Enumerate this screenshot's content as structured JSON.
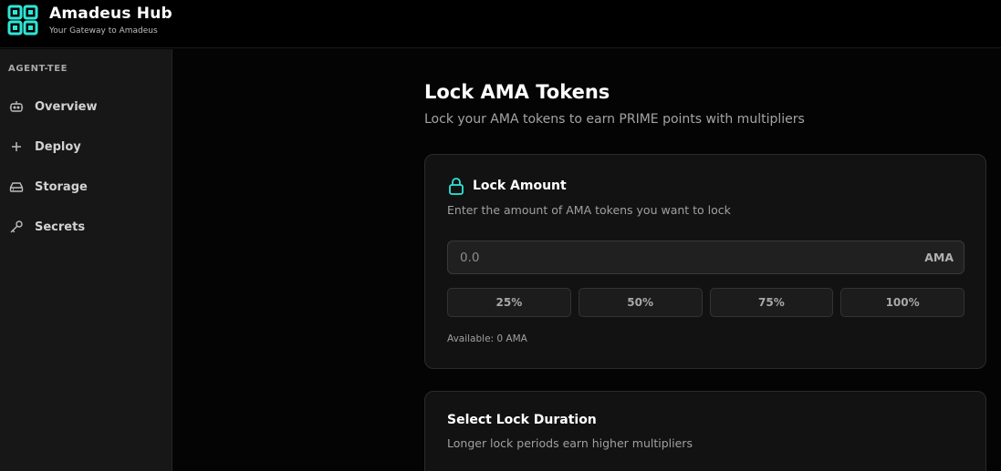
{
  "header": {
    "title": "Amadeus Hub",
    "subtitle": "Your Gateway to Amadeus",
    "logo_icon": "amadeus-logo-icon",
    "accent": "#2ee6d6"
  },
  "sidebar": {
    "heading": "AGENT-TEE",
    "items": [
      {
        "label": "Overview",
        "icon": "robot-icon"
      },
      {
        "label": "Deploy",
        "icon": "plus-icon"
      },
      {
        "label": "Storage",
        "icon": "hard-drive-icon"
      },
      {
        "label": "Secrets",
        "icon": "key-icon"
      }
    ]
  },
  "main": {
    "title": "Lock AMA Tokens",
    "subtitle": "Lock your AMA tokens to earn PRIME points with multipliers",
    "lock_amount": {
      "title": "Lock Amount",
      "icon": "lock-icon",
      "description": "Enter the amount of AMA tokens you want to lock",
      "input_placeholder": "0.0",
      "input_value": "",
      "unit": "AMA",
      "percent_buttons": [
        "25%",
        "50%",
        "75%",
        "100%"
      ],
      "available": "Available: 0 AMA"
    },
    "lock_duration": {
      "title": "Select Lock Duration",
      "description": "Longer lock periods earn higher multipliers"
    }
  }
}
